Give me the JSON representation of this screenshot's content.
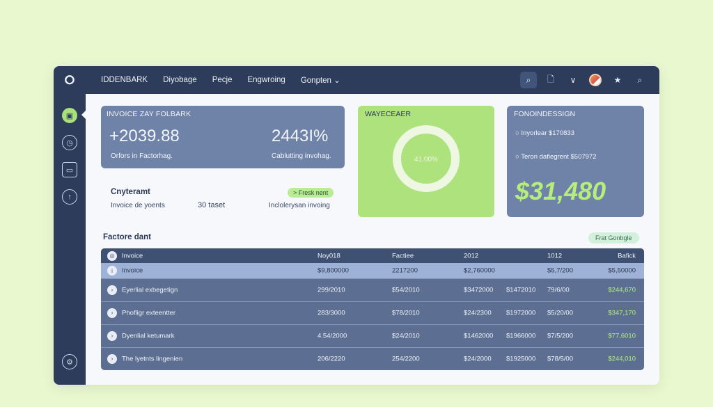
{
  "header": {
    "nav": [
      "IDDENBARK",
      "Diyobage",
      "Pecje",
      "Engwroing",
      "Gonpten ⌄"
    ],
    "tools": [
      "search-icon",
      "document-icon",
      "chevron-down-icon",
      "avatar",
      "star-icon",
      "search-icon"
    ]
  },
  "sidebar": {
    "items": [
      "dashboard-icon",
      "clock-icon",
      "inbox-icon",
      "upload-icon",
      "settings-icon"
    ]
  },
  "card_a": {
    "title": "INVOICE ZAY FOLBARK",
    "value_1": "+2039.88",
    "value_2": "2443I%",
    "label_1": "Orfors in Factorhag.",
    "label_2": "Cablutting invohag."
  },
  "info": {
    "heading": "Cnyteramt",
    "pill": "> Fresk nent",
    "col_1": "Invoice de yoents",
    "col_2": "30 taset",
    "col_3": "Inclolerysan invoing"
  },
  "card_b": {
    "title": "WAYECEAER",
    "donut_label": "41.00%",
    "donut_fraction": 1.0
  },
  "card_c": {
    "title": "FONOINDESSIGN",
    "row_1": "Inyorlear $170833",
    "row_2": "Teron dafiegrent $507972",
    "big_value": "$31,480"
  },
  "table": {
    "title": "Factore dant",
    "pill": "Frat Gonbgle",
    "headers": [
      "Invoice",
      "Noy018",
      "Factiee",
      "2012",
      "",
      "1012",
      "Bafick"
    ],
    "selected_row": [
      "Invoice",
      "$9,800000",
      "2217200",
      "$2,760000",
      "",
      "$5,7/200",
      "$5,50000"
    ],
    "rows": [
      [
        "Eyerlial exbegetign",
        "299/2010",
        "$54/2010",
        "$3472000",
        "$1472010",
        "79/6/00",
        "$244,670"
      ],
      [
        "Phofligr exteentter",
        "283/3000",
        "$78/2010",
        "$24/2300",
        "$1972000",
        "$5/20/00",
        "$347,170"
      ],
      [
        "Dyenlial ketumark",
        "4.54/2000",
        "$24/2010",
        "$1462000",
        "$1966000",
        "$7/5/200",
        "$77,6010"
      ],
      [
        "The lyetnts lingenien",
        "206/2220",
        "254/2200",
        "$24/2000",
        "$1925000",
        "$78/5/00",
        "$244,010"
      ]
    ]
  },
  "colors": {
    "accent_green": "#aee27d",
    "navy": "#2d3c5a",
    "slate": "#6f83a8"
  }
}
